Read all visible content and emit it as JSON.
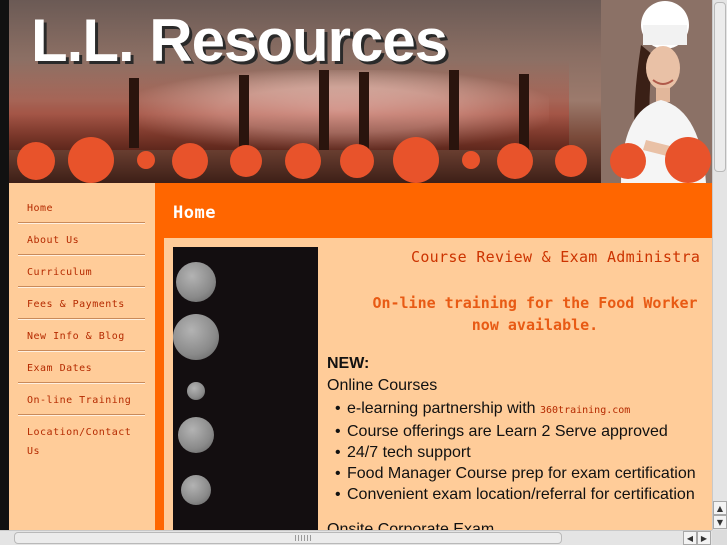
{
  "header": {
    "site_title": "L.L. Resources"
  },
  "sidebar": {
    "items": [
      {
        "label": "Home"
      },
      {
        "label": "About Us"
      },
      {
        "label": "Curriculum"
      },
      {
        "label": "Fees & Payments"
      },
      {
        "label": "New Info & Blog"
      },
      {
        "label": "Exam Dates"
      },
      {
        "label": "On-line Training"
      },
      {
        "label": "Location/Contact Us"
      }
    ]
  },
  "main": {
    "page_title": "Home",
    "review_heading": "Course Review & Exam Administra",
    "online_line1": "On-line training for the Food Worker",
    "online_line2": "now available.",
    "new_label": "NEW:",
    "courses_label": "Online Courses",
    "bullet1_prefix": "e-learning partnership with",
    "bullet1_link": "360training.com",
    "bullet2": "Course offerings are Learn 2 Serve approved",
    "bullet3": "24/7 tech support",
    "bullet4": "Food Manager Course prep for exam certification",
    "bullet5": "Convenient exam location/referral for certification",
    "cutoff_text": "Onsite Corporate Exam..."
  },
  "colors": {
    "accent_orange": "#ff6600",
    "sidebar_bg": "#ffcc99",
    "link_red": "#b52a00",
    "dot_orange": "#e8532b"
  },
  "icons": {
    "bullet": "•",
    "scroll_up": "▲",
    "scroll_down": "▼",
    "scroll_left": "◀",
    "scroll_right": "▶"
  }
}
